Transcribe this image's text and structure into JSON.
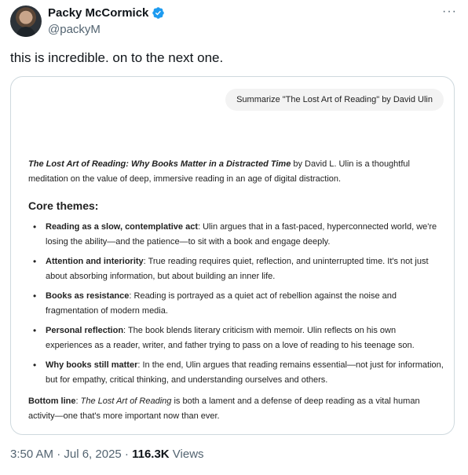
{
  "author": {
    "name": "Packy McCormick",
    "handle": "@packyM",
    "verified_color": "#1d9bf0"
  },
  "more_icon": "more-horizontal-icon",
  "tweet": {
    "text": "this is incredible. on to the next one."
  },
  "card": {
    "prompt": "Summarize \"The Lost Art of Reading\" by David Ulin",
    "intro_title": "The Lost Art of Reading: Why Books Matter in a Distracted Time",
    "intro_rest": " by David L. Ulin is a thoughtful meditation on the value of deep, immersive reading in an age of digital distraction.",
    "heading": "Core themes:",
    "themes": [
      {
        "title": "Reading as a slow, contemplative act",
        "text": ": Ulin argues that in a fast-paced, hyperconnected world, we're losing the ability—and the patience—to sit with a book and engage deeply."
      },
      {
        "title": "Attention and interiority",
        "text": ": True reading requires quiet, reflection, and uninterrupted time. It's not just about absorbing information, but about building an inner life."
      },
      {
        "title": "Books as resistance",
        "text": ": Reading is portrayed as a quiet act of rebellion against the noise and fragmentation of modern media."
      },
      {
        "title": "Personal reflection",
        "text": ": The book blends literary criticism with memoir. Ulin reflects on his own experiences as a reader, writer, and father trying to pass on a love of reading to his teenage son."
      },
      {
        "title": "Why books still matter",
        "text": ": In the end, Ulin argues that reading remains essential—not just for information, but for empathy, critical thinking, and understanding ourselves and others."
      }
    ],
    "bottom_label": "Bottom line",
    "bottom_pre": ": ",
    "bottom_title": "The Lost Art of Reading",
    "bottom_rest": " is both a lament and a defense of deep reading as a vital human activity—one that's more important now than ever."
  },
  "meta": {
    "time": "3:50 AM · Jul 6, 2025 · ",
    "views_count": "116.3K",
    "views_label": " Views"
  }
}
